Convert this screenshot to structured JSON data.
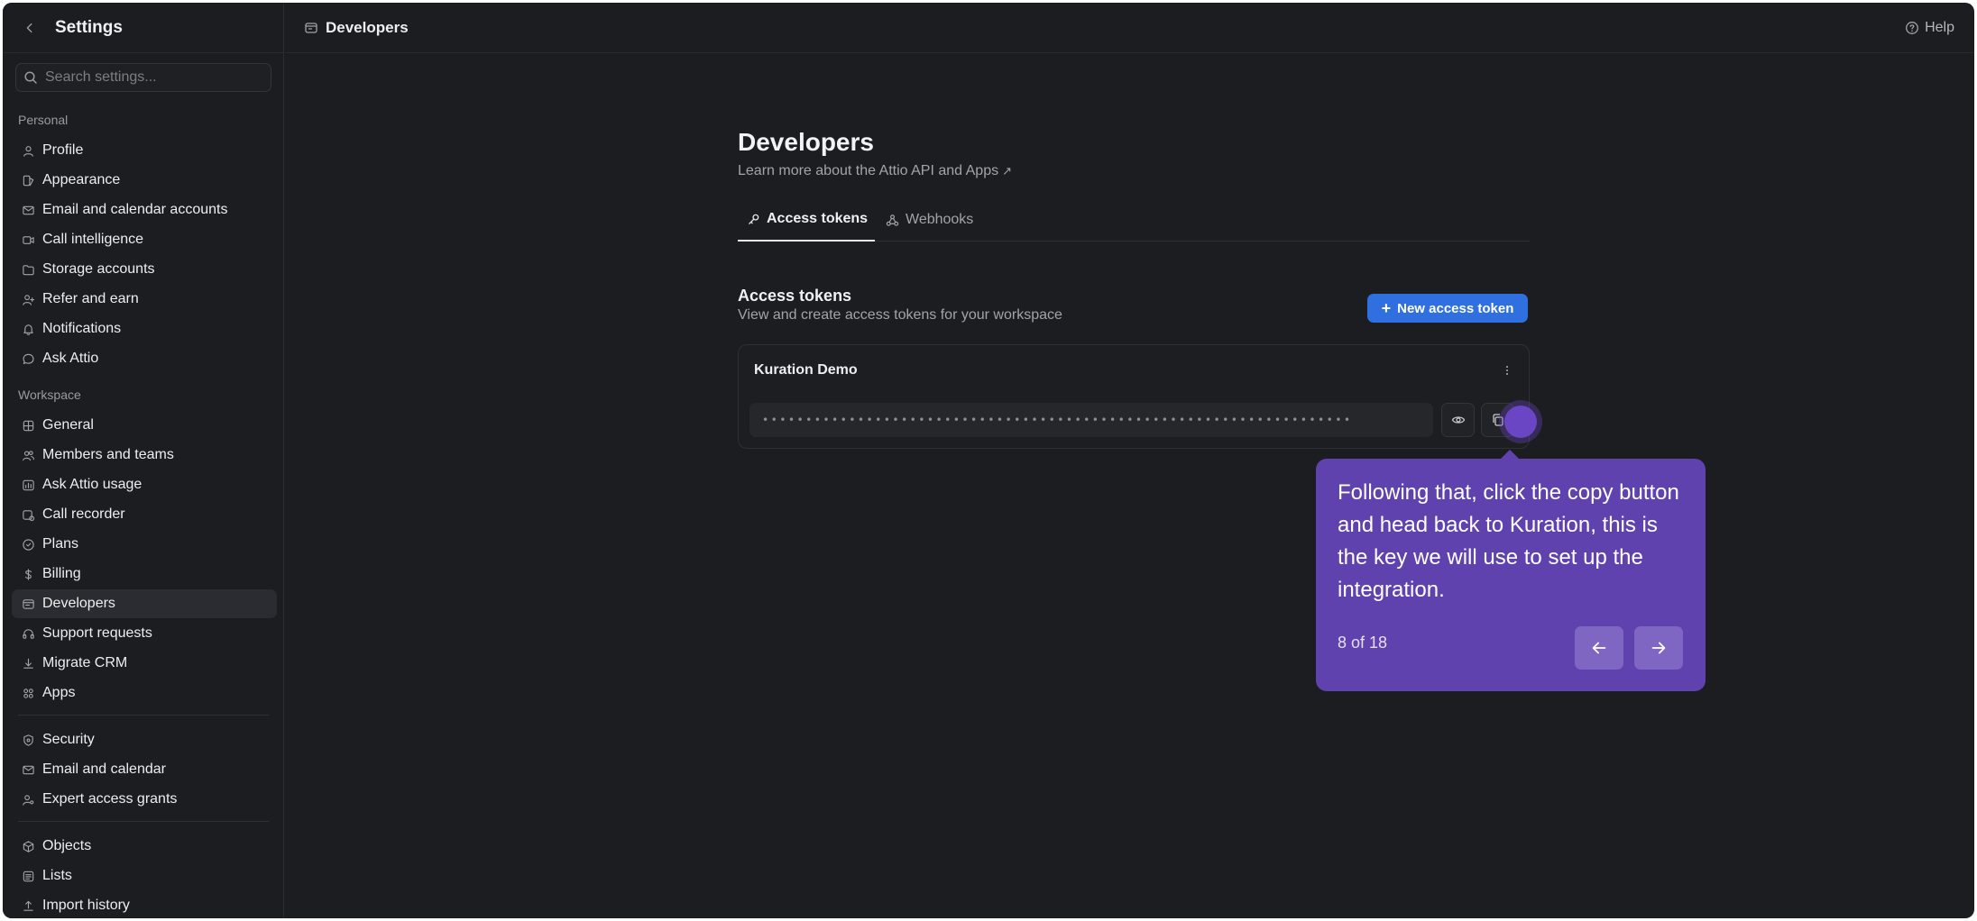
{
  "sidebar": {
    "title": "Settings",
    "search_placeholder": "Search settings...",
    "personal_label": "Personal",
    "workspace_label": "Workspace",
    "personal_items": [
      {
        "label": "Profile",
        "icon": "user-icon"
      },
      {
        "label": "Appearance",
        "icon": "palette-icon"
      },
      {
        "label": "Email and calendar accounts",
        "icon": "mail-calendar-icon"
      },
      {
        "label": "Call intelligence",
        "icon": "video-icon"
      },
      {
        "label": "Storage accounts",
        "icon": "folder-icon"
      },
      {
        "label": "Refer and earn",
        "icon": "user-plus-icon"
      },
      {
        "label": "Notifications",
        "icon": "bell-icon"
      },
      {
        "label": "Ask Attio",
        "icon": "chat-icon"
      }
    ],
    "workspace_items": [
      {
        "label": "General",
        "icon": "grid-icon"
      },
      {
        "label": "Members and teams",
        "icon": "users-icon"
      },
      {
        "label": "Ask Attio usage",
        "icon": "usage-icon"
      },
      {
        "label": "Call recorder",
        "icon": "recorder-icon"
      },
      {
        "label": "Plans",
        "icon": "plans-icon"
      },
      {
        "label": "Billing",
        "icon": "dollar-icon"
      },
      {
        "label": "Developers",
        "icon": "developers-icon",
        "active": true
      },
      {
        "label": "Support requests",
        "icon": "headset-icon"
      },
      {
        "label": "Migrate CRM",
        "icon": "download-icon"
      },
      {
        "label": "Apps",
        "icon": "apps-icon"
      }
    ],
    "security_items": [
      {
        "label": "Security",
        "icon": "shield-icon"
      },
      {
        "label": "Email and calendar",
        "icon": "envelope-icon"
      },
      {
        "label": "Expert access grants",
        "icon": "user-key-icon"
      }
    ],
    "data_items": [
      {
        "label": "Objects",
        "icon": "cube-icon"
      },
      {
        "label": "Lists",
        "icon": "list-icon"
      },
      {
        "label": "Import history",
        "icon": "upload-icon"
      }
    ]
  },
  "topbar": {
    "breadcrumb": "Developers",
    "help_label": "Help"
  },
  "main": {
    "title": "Developers",
    "subtitle": "Learn more about the Attio API and Apps",
    "subtitle_arrow": "↗",
    "tabs": [
      {
        "label": "Access tokens",
        "active": true
      },
      {
        "label": "Webhooks",
        "active": false
      }
    ],
    "section_title": "Access tokens",
    "section_subtitle": "View and create access tokens for your workspace",
    "new_button_label": "New access token",
    "new_button_plus": "+",
    "token": {
      "name": "Kuration Demo",
      "masked_value": "••••••••••••••••••••••••••••••••••••••••••••••••••••••••••••••••••••"
    }
  },
  "tooltip": {
    "message": "Following that, click the copy button and head back to Kuration, this is the key we will use to set up the integration.",
    "step_count": "8 of 18"
  },
  "colors": {
    "background": "#1c1d21",
    "accent_blue": "#2f6fe0",
    "tooltip_purple": "#5f42ad"
  }
}
